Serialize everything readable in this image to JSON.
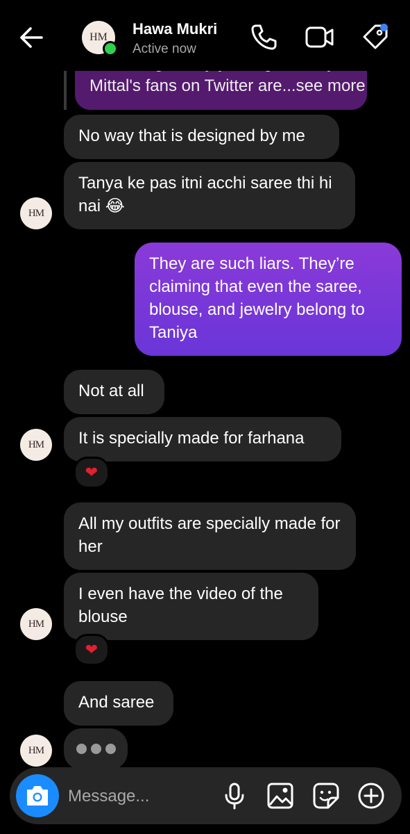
{
  "header": {
    "contact_name": "Hawa Mukri",
    "status": "Active now",
    "avatar_initials": "HM",
    "icons": [
      "back-arrow-icon",
      "phone-icon",
      "video-camera-icon",
      "tag-icon"
    ],
    "online_color": "#2fcf4f",
    "notification_dot_color": "#3b82f6"
  },
  "messages": [
    {
      "direction": "incoming-quoted",
      "text_line1": "was designed by you, right? Tanya",
      "text_line2": "Mittal's fans on Twitter are...see more"
    },
    {
      "direction": "incoming",
      "text": "No way that is designed by me"
    },
    {
      "direction": "incoming",
      "text": "Tanya ke pas itni acchi saree thi hi nai 😂"
    },
    {
      "direction": "outgoing",
      "text": "They are such liars. They’re claiming that even the saree, blouse, and jewelry belong to Taniya"
    },
    {
      "direction": "incoming",
      "text": "Not at all"
    },
    {
      "direction": "incoming",
      "text": "It is specially made for farhana",
      "reaction": "❤"
    },
    {
      "direction": "incoming",
      "text": "All my outfits are specially made for her"
    },
    {
      "direction": "incoming",
      "text": "I even have the video of the blouse",
      "reaction": "❤"
    },
    {
      "direction": "incoming",
      "text": "And saree"
    }
  ],
  "typing_indicator": "•••",
  "composer": {
    "placeholder": "Message...",
    "icons": [
      "camera-icon",
      "microphone-icon",
      "gallery-icon",
      "sticker-icon",
      "add-icon"
    ],
    "camera_color": "#1a8cff"
  },
  "colors": {
    "background": "#000000",
    "incoming_bubble": "#262626",
    "outgoing_bubble_top": "#8a3ad8",
    "outgoing_bubble_bottom": "#6a35d8",
    "quoted_bubble": "#541a6e"
  }
}
